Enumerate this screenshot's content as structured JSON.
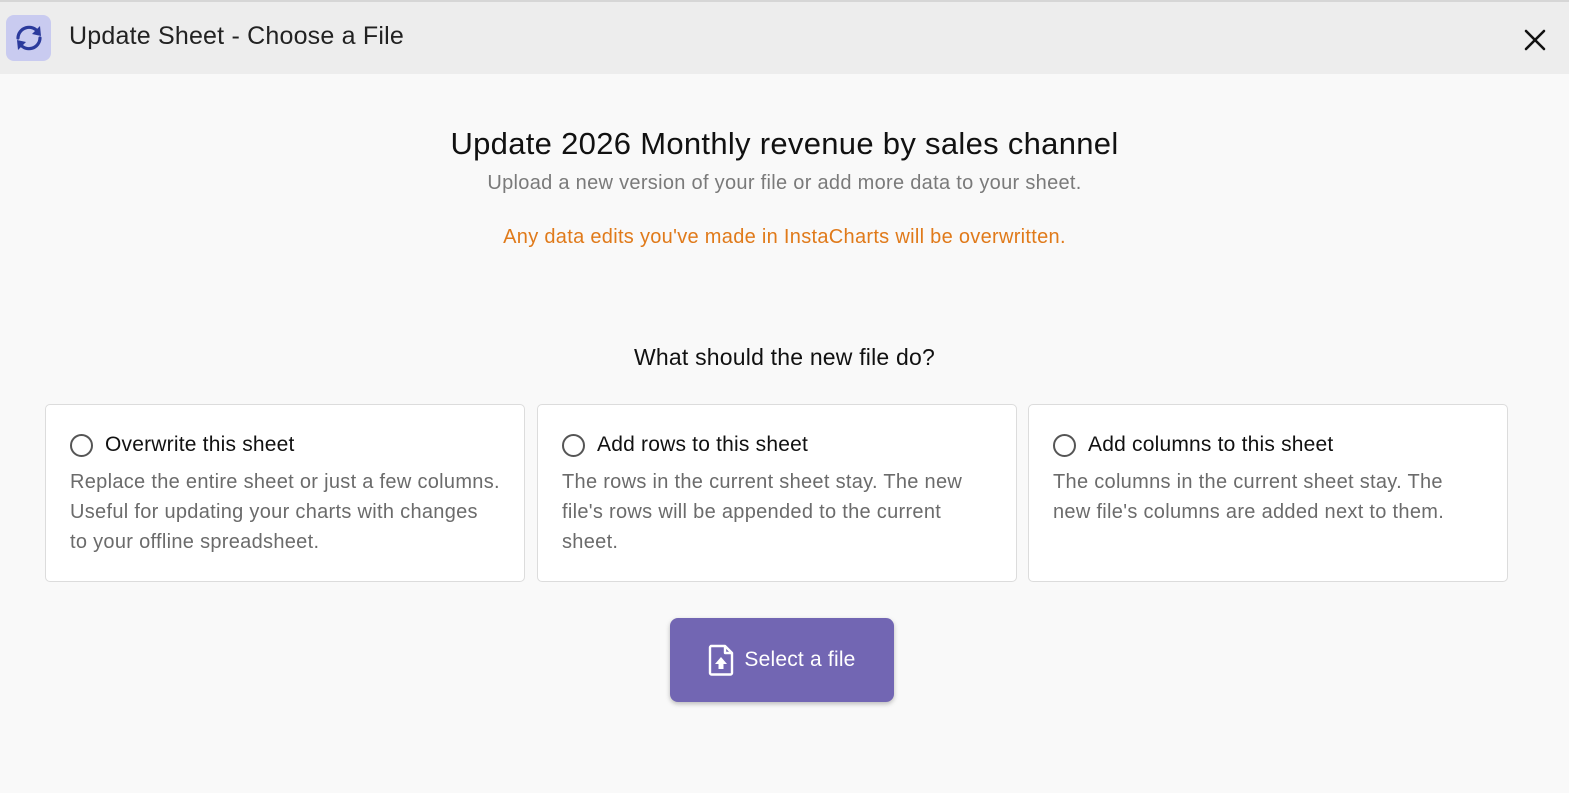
{
  "header": {
    "title": "Update Sheet - Choose a File",
    "icon": "refresh-icon",
    "close_icon": "close-icon"
  },
  "main": {
    "title": "Update 2026 Monthly revenue by sales channel",
    "subtitle": "Upload a new version of your file or add more data to your sheet.",
    "warning": "Any data edits you've made in InstaCharts will be overwritten.",
    "question": "What should the new file do?"
  },
  "options": [
    {
      "title": "Overwrite this sheet",
      "description": "Replace the entire sheet or just a few columns. Useful for updating your charts with changes to your offline spreadsheet.",
      "selected": false
    },
    {
      "title": "Add rows to this sheet",
      "description": "The rows in the current sheet stay. The new file's rows will be appended to the current sheet.",
      "selected": false
    },
    {
      "title": "Add columns to this sheet",
      "description": "The columns in the current sheet stay. The new file's columns are added next to them.",
      "selected": false
    }
  ],
  "select_button": {
    "label": "Select a file",
    "icon": "file-upload-icon"
  },
  "colors": {
    "accent": "#7266b3",
    "warning": "#e07a1a",
    "icon_bg": "#c9cbf0",
    "icon_fg": "#2b3a9c"
  }
}
